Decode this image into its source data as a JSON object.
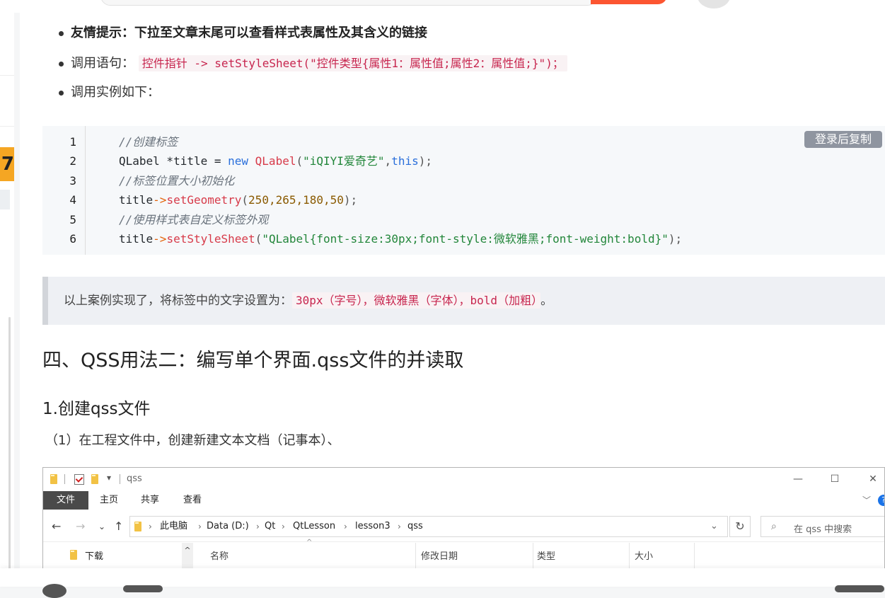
{
  "article": {
    "bullets": {
      "tip": "友情提示：下拉至文章末尾可以查看样式表属性及其含义的链接",
      "call_prefix": "调用语句：",
      "call_code": "控件指针 -> setStyleSheet(\"控件类型{属性1：属性值;属性2：属性值;}\")；",
      "example": "调用实例如下："
    },
    "code": {
      "copy_label": "登录后复制",
      "line_numbers": [
        "1",
        "2",
        "3",
        "4",
        "5",
        "6"
      ],
      "l1_comment": "//创建标签",
      "l2_type": "QLabel",
      "l2_rest": " *title = ",
      "l2_new": "new",
      "l2_ctor": " QLabel",
      "l2_open": "(",
      "l2_str": "\"iQIYI爱奇艺\"",
      "l2_comma": ",",
      "l2_this": "this",
      "l2_close": ");",
      "l3_comment": "//标签位置大小初始化",
      "l4_obj": "title",
      "l4_arrow": "->",
      "l4_fn": "setGeometry",
      "l4_open": "(",
      "l4_args": "250,265,180,50",
      "l4_close": ");",
      "l5_comment": "//使用样式表自定义标签外观",
      "l6_obj": "title",
      "l6_arrow": "->",
      "l6_fn": "setStyleSheet",
      "l6_open": "(",
      "l6_str": "\"QLabel{font-size:30px;font-style:微软雅黑;font-weight:bold}\"",
      "l6_close": ");"
    },
    "quote": {
      "prefix": "以上案例实现了，将标签中的文字设置为：",
      "code": "30px（字号），微软雅黑（字体），bold（加粗）",
      "suffix": "。"
    },
    "h2": "四、QSS用法二：编写单个界面.qss文件的并读取",
    "h3": "1.创建qss文件",
    "para": "（1）在工程文件中，创建新建文本文档（记事本）、"
  },
  "explorer": {
    "title": "qss",
    "ribbon_tabs": [
      "文件",
      "主页",
      "共享",
      "查看"
    ],
    "help_icon": "?",
    "path": [
      "此电脑",
      "Data (D:)",
      "Qt",
      "QtLesson",
      "lesson3",
      "qss"
    ],
    "search_placeholder": "在 qss 中搜索",
    "nav_item": "下载",
    "columns": [
      "名称",
      "修改日期",
      "类型",
      "大小"
    ]
  }
}
